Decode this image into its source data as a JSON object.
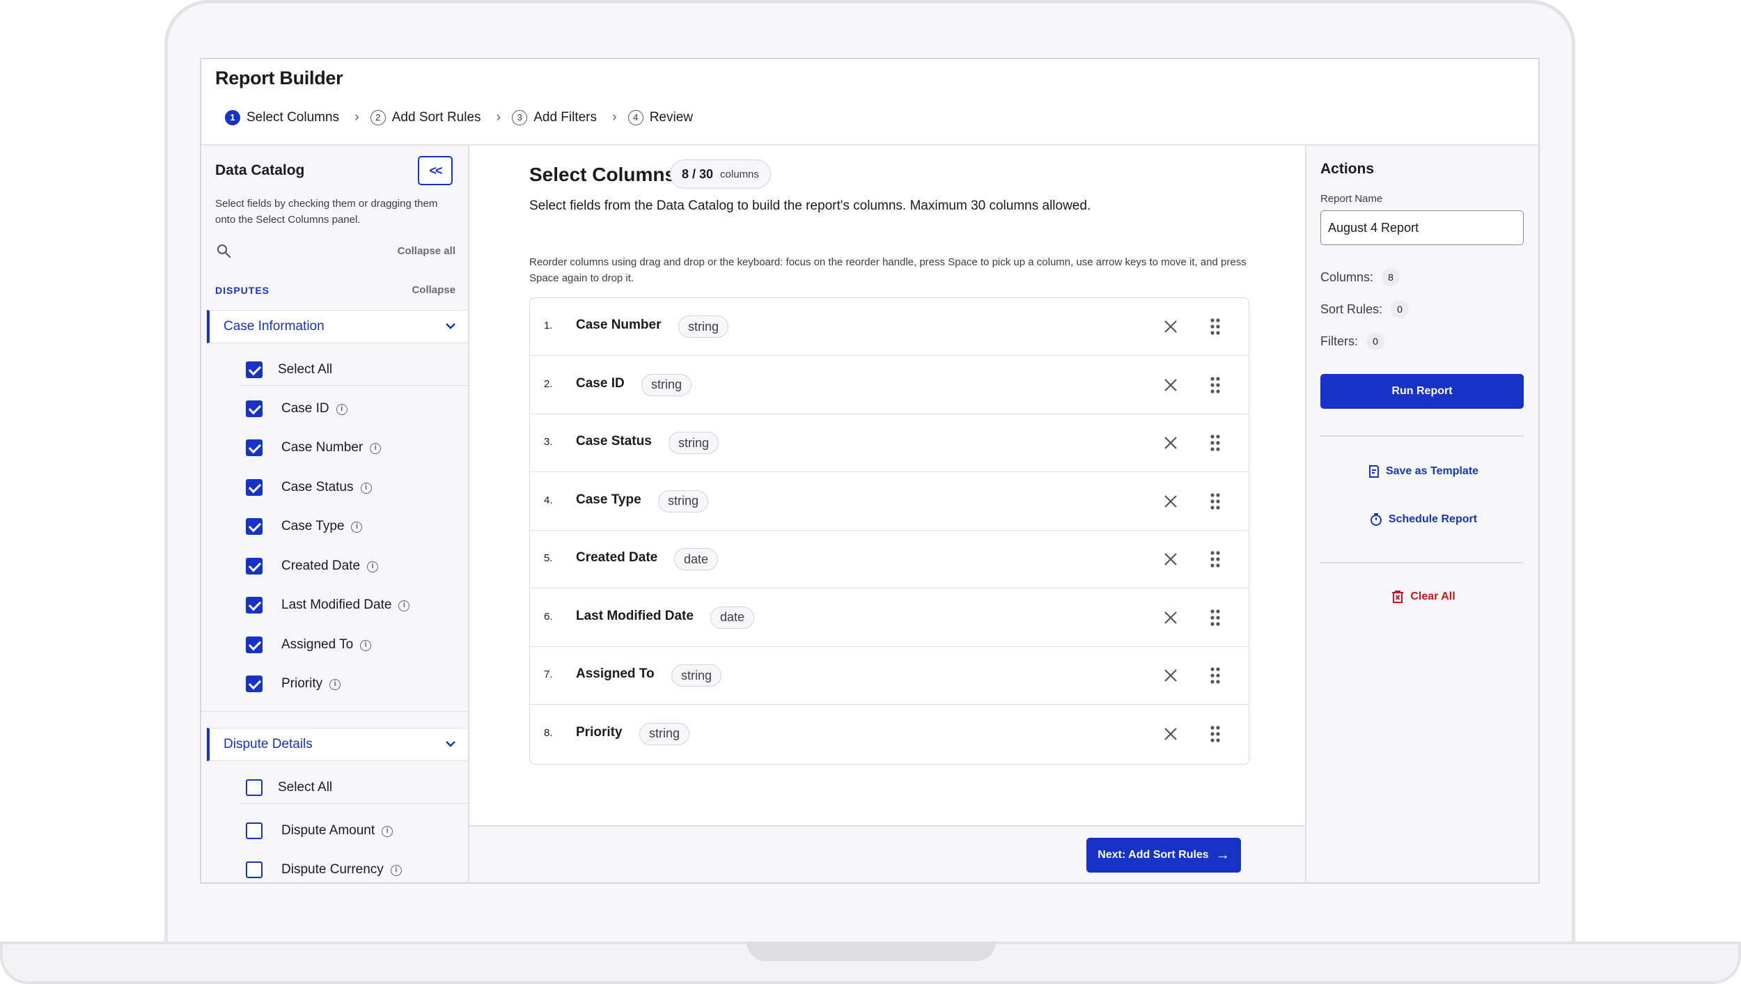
{
  "app": {
    "title": "Report Builder"
  },
  "stepper": [
    {
      "num": "1",
      "label": "Select Columns"
    },
    {
      "num": "2",
      "label": "Add Sort Rules"
    },
    {
      "num": "3",
      "label": "Add Filters"
    },
    {
      "num": "4",
      "label": "Review"
    }
  ],
  "catalog": {
    "title": "Data Catalog",
    "collapse_button": "<<",
    "description": "Select fields by checking them or dragging them onto the Select Columns panel.",
    "collapse_all": "Collapse all",
    "group": {
      "label": "DISPUTES",
      "collapse": "Collapse"
    },
    "sections": [
      {
        "title": "Case Information",
        "select_all": {
          "label": "Select All",
          "checked": true
        },
        "fields": [
          {
            "label": "Case ID",
            "checked": true
          },
          {
            "label": "Case Number",
            "checked": true
          },
          {
            "label": "Case Status",
            "checked": true
          },
          {
            "label": "Case Type",
            "checked": true
          },
          {
            "label": "Created Date",
            "checked": true
          },
          {
            "label": "Last Modified Date",
            "checked": true
          },
          {
            "label": "Assigned To",
            "checked": true
          },
          {
            "label": "Priority",
            "checked": true
          }
        ]
      },
      {
        "title": "Dispute Details",
        "select_all": {
          "label": "Select All",
          "checked": false
        },
        "fields": [
          {
            "label": "Dispute Amount",
            "checked": false
          },
          {
            "label": "Dispute Currency",
            "checked": false
          }
        ]
      }
    ]
  },
  "main": {
    "title": "Select Columns",
    "count": "8 / 30",
    "count_unit": "columns",
    "description": "Select fields from the Data Catalog to build the report's columns. Maximum 30 columns allowed.",
    "reorder_hint": "Reorder columns using drag and drop or the keyboard: focus on the reorder handle, press Space to pick up a column, use arrow keys to move it, and press Space again to drop it.",
    "columns": [
      {
        "index": "1.",
        "name": "Case Number",
        "type": "string"
      },
      {
        "index": "2.",
        "name": "Case ID",
        "type": "string"
      },
      {
        "index": "3.",
        "name": "Case Status",
        "type": "string"
      },
      {
        "index": "4.",
        "name": "Case Type",
        "type": "string"
      },
      {
        "index": "5.",
        "name": "Created Date",
        "type": "date"
      },
      {
        "index": "6.",
        "name": "Last Modified Date",
        "type": "date"
      },
      {
        "index": "7.",
        "name": "Assigned To",
        "type": "string"
      },
      {
        "index": "8.",
        "name": "Priority",
        "type": "string"
      }
    ],
    "next_button": "Next: Add Sort Rules"
  },
  "actions": {
    "title": "Actions",
    "report_name_label": "Report Name",
    "report_name_value": "August 4 Report",
    "stats": [
      {
        "label": "Columns:",
        "value": "8"
      },
      {
        "label": "Sort Rules:",
        "value": "0"
      },
      {
        "label": "Filters:",
        "value": "0"
      }
    ],
    "run_button": "Run Report",
    "save_template": "Save as Template",
    "schedule": "Schedule Report",
    "clear_all": "Clear All"
  },
  "colors": {
    "accent": "#1733c7",
    "danger": "#c4161c"
  }
}
